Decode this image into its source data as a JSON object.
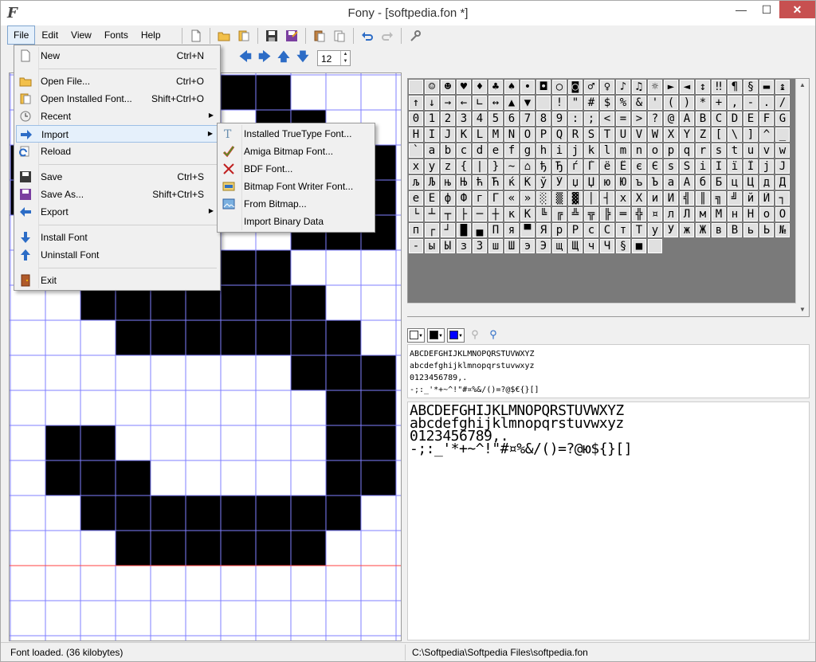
{
  "window": {
    "title": "Fony - [softpedia.fon *]",
    "app_icon": "F",
    "controls": {
      "minimize": "—",
      "maximize": "☐",
      "close": "✕"
    }
  },
  "menubar": [
    "File",
    "Edit",
    "View",
    "Fonts",
    "Help"
  ],
  "toolbar": {
    "icons": [
      "new-icon",
      "open-icon",
      "open-installed-icon",
      "save-icon",
      "save-as-icon",
      "copy-icon",
      "paste-icon",
      "undo-icon",
      "redo-icon",
      "settings-icon"
    ],
    "nav_icons": [
      "arrow-left-icon",
      "arrow-right-icon",
      "arrow-up-icon",
      "arrow-down-icon"
    ],
    "size_value": "12"
  },
  "file_menu": [
    {
      "label": "New",
      "shortcut": "Ctrl+N",
      "icon": "new-file-icon"
    },
    {
      "sep": true
    },
    {
      "label": "Open File...",
      "shortcut": "Ctrl+O",
      "icon": "folder-open-icon"
    },
    {
      "label": "Open Installed Font...",
      "shortcut": "Shift+Ctrl+O",
      "icon": "open-installed-font-icon"
    },
    {
      "label": "Recent",
      "shortcut": "",
      "icon": "clock-icon",
      "submenu": true
    },
    {
      "label": "Import",
      "shortcut": "",
      "icon": "import-arrow-icon",
      "submenu": true,
      "highlight": true
    },
    {
      "label": "Reload",
      "shortcut": "",
      "icon": "reload-icon"
    },
    {
      "sep": true
    },
    {
      "label": "Save",
      "shortcut": "Ctrl+S",
      "icon": "floppy-icon"
    },
    {
      "label": "Save As...",
      "shortcut": "Shift+Ctrl+S",
      "icon": "save-as-icon"
    },
    {
      "label": "Export",
      "shortcut": "",
      "icon": "export-arrow-icon",
      "submenu": true
    },
    {
      "sep": true
    },
    {
      "label": "Install Font",
      "shortcut": "",
      "icon": "install-arrow-icon"
    },
    {
      "label": "Uninstall Font",
      "shortcut": "",
      "icon": "uninstall-arrow-icon"
    },
    {
      "sep": true
    },
    {
      "label": "Exit",
      "shortcut": "",
      "icon": "exit-door-icon"
    }
  ],
  "import_menu": [
    {
      "label": "Installed TrueType Font...",
      "icon": "truetype-icon"
    },
    {
      "label": "Amiga Bitmap Font...",
      "icon": "amiga-check-icon"
    },
    {
      "label": "BDF Font...",
      "icon": "bdf-icon"
    },
    {
      "label": "Bitmap Font Writer Font...",
      "icon": "bmfw-icon"
    },
    {
      "label": "From Bitmap...",
      "icon": "bitmap-icon"
    },
    {
      "label": "Import Binary Data",
      "icon": ""
    }
  ],
  "charmap_rows": [
    " ☺☻♥♦♣♠•◘○◙♂♀♪♫☼►◄↕‼¶§▬↨",
    "↑↓→←∟↔▲▼ !\"#$%&'()*+,-./",
    "0123456789:;<=>?@ABCDEFG",
    "HIJKLMNOPQRSTUVWXYZ[\\]^_",
    "`abcdefghijklmnopqrstuvw",
    "xyz{|}~⌂ђЂѓЃёЁєЄѕЅіІїЇјЈ",
    "љЉњЊћЋќЌўЎџЏюЮъЪаАбБцЦдД",
    "еЕфФгГ«»░▒▓│┤хХиИ╣║╗╝йЙ┐",
    "└┴┬├─┼кК╚╔╩╦╠═╬¤лЛмМнНоО",
    "п┌┘█▄Пя▀ЯрРсСтТуУжЖвВьЬ№",
    "-ыЫзЗшШэЭщЩчЧ§■ "
  ],
  "selected_char": "S",
  "preview_small": [
    "ABCDEFGHIJKLMNOPQRSTUVWXYZ",
    "abcdefghijklmnopqrstuvwxyz",
    "0123456789,.",
    "-;:_'*+~^!\"#¤%&/()=?@$€{}[]"
  ],
  "preview_big": [
    "ABCDEFGHIJKLMNOPQRSTUVWXYZ",
    "abcdefghijklmnopqrstuvwxyz",
    "0123456789,.",
    "-;:_'*+~^!\"#¤%&/()=?@ю${}[]"
  ],
  "status": {
    "message": "Font loaded. (36 kilobytes)",
    "path": "C:\\Softpedia\\Softpedia Files\\softpedia.fon"
  },
  "colors": {
    "grid_line": "#7f7fff",
    "baseline": "#ff4040",
    "pixel_on": "#000000",
    "selection": "#ffd800",
    "highlight": "#e5f0fb",
    "close_button": "#c75050",
    "fg_swatch": "#000000",
    "bg_swatch": "#0000ff"
  }
}
